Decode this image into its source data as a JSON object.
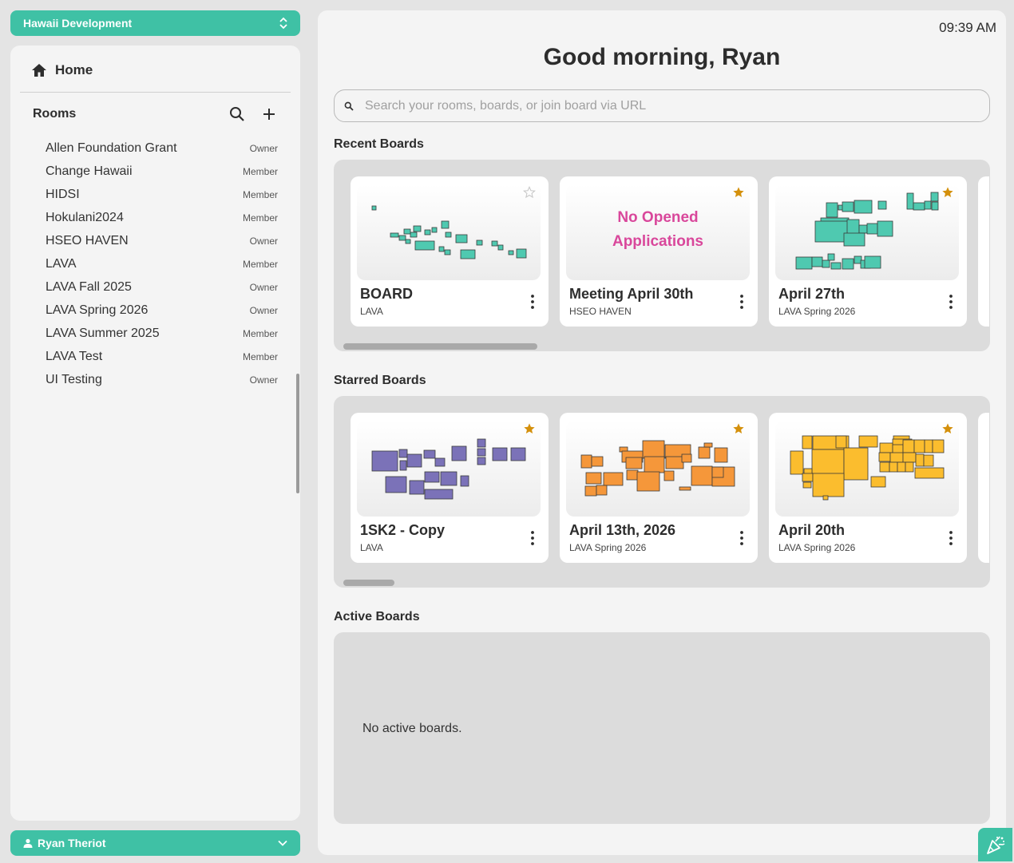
{
  "org_selector": {
    "label": "Hawaii Development"
  },
  "sidebar": {
    "home_label": "Home",
    "rooms_title": "Rooms",
    "rooms": [
      {
        "name": "Allen Foundation Grant",
        "role": "Owner"
      },
      {
        "name": "Change Hawaii",
        "role": "Member"
      },
      {
        "name": "HIDSI",
        "role": "Member"
      },
      {
        "name": "Hokulani2024",
        "role": "Member"
      },
      {
        "name": "HSEO HAVEN",
        "role": "Owner"
      },
      {
        "name": "LAVA",
        "role": "Member"
      },
      {
        "name": "LAVA Fall 2025",
        "role": "Owner"
      },
      {
        "name": "LAVA Spring 2026",
        "role": "Owner"
      },
      {
        "name": "LAVA Summer 2025",
        "role": "Member"
      },
      {
        "name": "LAVA Test",
        "role": "Member"
      },
      {
        "name": "UI Testing",
        "role": "Owner"
      }
    ]
  },
  "user_selector": {
    "label": "Ryan Theriot"
  },
  "header": {
    "time": "09:39 AM",
    "greeting": "Good morning, Ryan",
    "search_placeholder": "Search your rooms, boards, or join board via URL"
  },
  "recent": {
    "title": "Recent Boards",
    "cards": [
      {
        "title": "BOARD",
        "room": "LAVA",
        "starred": false,
        "thumb_color": "#4fc9b0",
        "empty": false
      },
      {
        "title": "Meeting April 30th",
        "room": "HSEO HAVEN",
        "starred": true,
        "empty": true,
        "empty_line1": "No Opened",
        "empty_line2": "Applications"
      },
      {
        "title": "April 27th",
        "room": "LAVA Spring 2026",
        "starred": true,
        "thumb_color": "#4fc9b0",
        "empty": false
      }
    ]
  },
  "starred": {
    "title": "Starred Boards",
    "cards": [
      {
        "title": "1SK2 - Copy",
        "room": "LAVA",
        "starred": true,
        "thumb_color": "#7b72b8"
      },
      {
        "title": "April 13th, 2026",
        "room": "LAVA Spring 2026",
        "starred": true,
        "thumb_color": "#f5973a"
      },
      {
        "title": "April 20th",
        "room": "LAVA Spring 2026",
        "starred": true,
        "thumb_color": "#fbbd2e"
      }
    ]
  },
  "active": {
    "title": "Active Boards",
    "empty_text": "No active boards."
  },
  "colors": {
    "accent": "#3fc1a5",
    "star": "#d4900c",
    "no_apps": "#d9479b"
  },
  "icons": [
    "chevron-up-down-icon",
    "home-icon",
    "search-icon",
    "plus-icon",
    "user-icon",
    "chevron-down-icon",
    "star-icon",
    "kebab-icon",
    "party-popper-icon"
  ]
}
